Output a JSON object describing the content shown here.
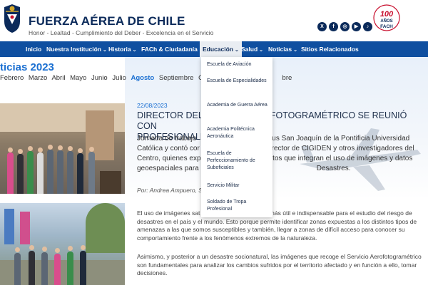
{
  "header": {
    "title": "FUERZA AÉREA DE CHILE",
    "tagline": "Honor - Lealtad - Cumplimiento del Deber - Excelencia en el Servicio",
    "anniversary_number": "100",
    "anniversary_word": "AÑOS",
    "anniversary_brand": "FACH",
    "social_icons": [
      "x-icon",
      "facebook-icon",
      "instagram-icon",
      "youtube-icon",
      "tiktok-icon"
    ]
  },
  "nav": {
    "items": [
      {
        "label": "Inicio",
        "has_dropdown": false
      },
      {
        "label": "Nuestra Institución",
        "has_dropdown": true
      },
      {
        "label": "Historia",
        "has_dropdown": true
      },
      {
        "label": "FACh & Ciudadanía",
        "has_dropdown": true
      },
      {
        "label": "Educación",
        "has_dropdown": true
      },
      {
        "label": "Salud",
        "has_dropdown": true
      },
      {
        "label": "Noticias",
        "has_dropdown": true
      },
      {
        "label": "Sitios Relacionados",
        "has_dropdown": false
      }
    ],
    "chevron": "⌄"
  },
  "news": {
    "heading": "ticias 2023",
    "months": [
      "Febrero",
      "Marzo",
      "Abril",
      "Mayo",
      "Junio",
      "Julio",
      "Agosto",
      "Septiembre",
      "Oct",
      "bre"
    ],
    "active_month": "Agosto"
  },
  "dropdown": {
    "items": [
      "Escuela de Aviación",
      "Escuela de Especialidades",
      "Academia de Guerra Aérea",
      "Academia Politécnica Aeronáutica",
      "Escuela de Perfeccionamiento de Suboficiales",
      "Servicio Militar",
      "Soldado de Tropa Profesional"
    ]
  },
  "article": {
    "date": "22/08/2023",
    "title": "DIRECTOR DEL                                  FOTOGRAMÉTRICO SE REUNIÓ CON PROFESIONALE",
    "title_left": "DIRECTOR DEL",
    "title_right": "FOTOGRAMÉTRICO SE REUNIÓ CON",
    "title_line2": "PROFESIONALE",
    "lead_l1a": "Jornada de trabajo",
    "lead_l1b": "mpus San Joaquín de la Pontificia Universidad",
    "lead_l2a": "Católica y contó cor",
    "lead_l2b": "l director de CIGIDEN y otros investigadores del",
    "lead_l3a": "Centro, quienes exp",
    "lead_l3b": "ectos que integran el uso de imágenes y datos",
    "lead_l4a": "geoespaciales para l",
    "lead_l4b": "Desastres.",
    "author": "Por: Andrea Ampuero, S",
    "para1_l1a": "El uso de imágenes sat",
    "para1_l1b": "ía más útil e indispensable para el estudio del riesgo de",
    "para1_l2a": "desastres en el país y el mundo.",
    "para1_l2b": " Esto porque permite identificar zonas expuestas a los distintos tipos de amenazas a las que somos susceptibles y también, llegar a zonas de difícil acceso para conocer su comportamiento frente a los fenómenos extremos de la naturaleza.",
    "para2": "Asimismo, y posterior a un desastre socionatural, las imágenes que recoge el Servicio Aerofotogramétrico son fundamentales para analizar los cambios sufridos por el territorio afectado y en función a ello, tomar decisiones."
  },
  "colors": {
    "nav_bg": "#0f4fa0",
    "title_navy": "#0b2a5a",
    "accent_blue": "#1a6fd1"
  }
}
